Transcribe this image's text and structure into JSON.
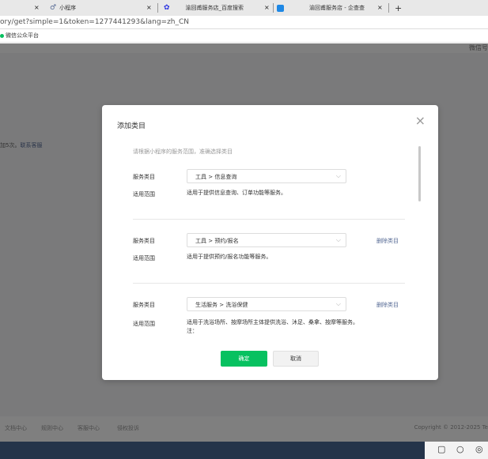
{
  "browser": {
    "tabs": [
      {
        "label": "",
        "close": "×"
      },
      {
        "label": "小程序",
        "close": "×"
      },
      {
        "label": "渝回甫服务店_百度搜索",
        "close": "×"
      },
      {
        "label": "渝回甫服务店 - 企查查",
        "close": "×"
      }
    ],
    "new_tab": "+",
    "address": "ory/get?simple=1&token=1277441293&lang=zh_CN",
    "bookmark": "微信公众平台"
  },
  "page": {
    "header_right": "微信号",
    "tip_text": "加5次。",
    "tip_link": "联系客服",
    "footer": [
      "文档中心",
      "规则中心",
      "客服中心",
      "侵权投诉"
    ],
    "copyright": "Copyright © 2012-2025 Te"
  },
  "modal": {
    "title": "添加类目",
    "close": "×",
    "hint": "请根据小程序的服务范围，准确选择类目",
    "service_label": "服务类目",
    "scope_label": "适用范围",
    "delete_label": "删除类目",
    "arrow": "⌵",
    "categories": [
      {
        "path": "工具 > 信息查询",
        "scope": "适用于提供信息查询、订单功能等服务。"
      },
      {
        "path": "工具 > 预约/报名",
        "scope": "适用于提供预约/报名功能等服务。"
      },
      {
        "path": "生活服务 > 洗浴保健",
        "scope": "适用于洗浴场所、按摩场所主体提供洗浴、沐足、桑拿、按摩等服务。",
        "scope_extra": "注："
      }
    ],
    "confirm": "确定",
    "cancel": "取消"
  },
  "taskbar": {
    "icons": [
      "▢",
      "○",
      "◎"
    ]
  }
}
